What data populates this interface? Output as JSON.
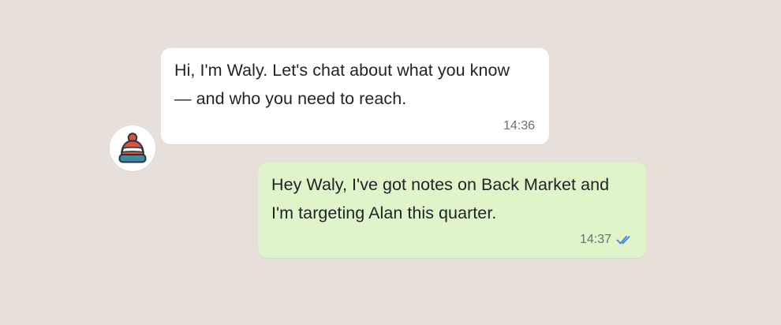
{
  "colors": {
    "background": "#e7e0da",
    "incoming_bubble": "#ffffff",
    "outgoing_bubble": "#dff5c9",
    "read_receipt": "#4a7fe0"
  },
  "avatar": {
    "icon": "beanie-hat-icon"
  },
  "messages": [
    {
      "direction": "incoming",
      "lines": [
        "Hi, I'm Waly. Let's chat about what you know",
        "— and who you need to reach."
      ],
      "time": "14:36"
    },
    {
      "direction": "outgoing",
      "lines": [
        "Hey Waly, I've got notes on Back Market and",
        "I'm targeting Alan this quarter."
      ],
      "time": "14:37",
      "status_icon": "double-check-icon"
    }
  ]
}
